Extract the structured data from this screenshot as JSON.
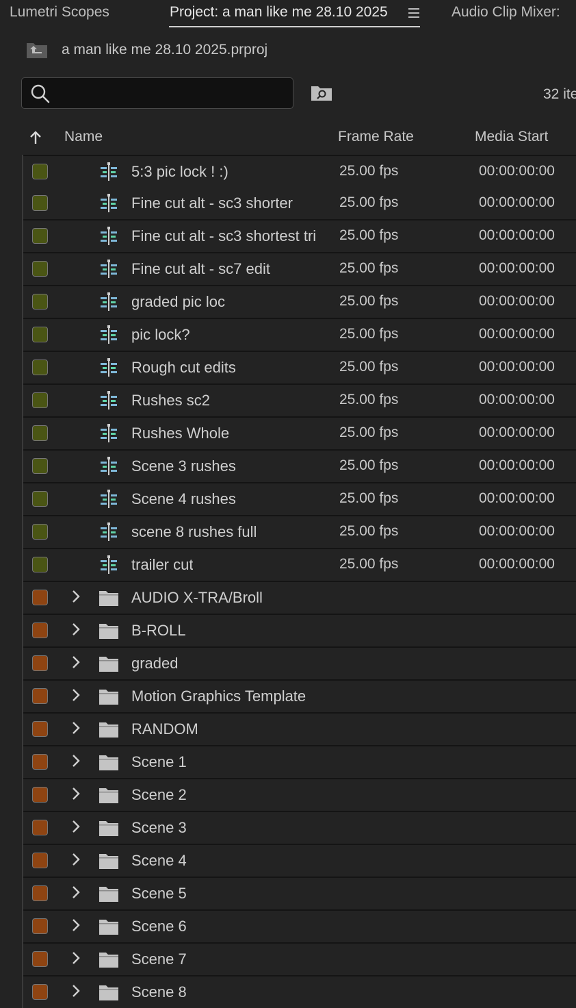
{
  "tabs": {
    "lumetri": "Lumetri Scopes",
    "project": "Project: a man like me 28.10 2025",
    "audio_mixer": "Audio Clip Mixer:"
  },
  "project": {
    "file_name": "a man like me 28.10 2025.prproj"
  },
  "search": {
    "value": "",
    "placeholder": ""
  },
  "items_count": "32 ite",
  "columns": {
    "name": "Name",
    "frame_rate": "Frame Rate",
    "media_start": "Media Start"
  },
  "colors": {
    "sequence_label": "#4a5514",
    "bin_label": "#8e4412",
    "sequence_icon": "#7fb8d8",
    "sequence_icon_accent": "#5fd3a8"
  },
  "rows": [
    {
      "type": "sequence",
      "name": "5:3 pic lock ! :)",
      "frame_rate": "25.00 fps",
      "media_start": "00:00:00:00"
    },
    {
      "type": "sequence",
      "name": "Fine cut alt - sc3 shorter",
      "frame_rate": "25.00 fps",
      "media_start": "00:00:00:00"
    },
    {
      "type": "sequence",
      "name": "Fine cut alt - sc3 shortest tri",
      "frame_rate": "25.00 fps",
      "media_start": "00:00:00:00"
    },
    {
      "type": "sequence",
      "name": "Fine cut alt - sc7 edit",
      "frame_rate": "25.00 fps",
      "media_start": "00:00:00:00"
    },
    {
      "type": "sequence",
      "name": "graded pic loc",
      "frame_rate": "25.00 fps",
      "media_start": "00:00:00:00"
    },
    {
      "type": "sequence",
      "name": "pic lock?",
      "frame_rate": "25.00 fps",
      "media_start": "00:00:00:00"
    },
    {
      "type": "sequence",
      "name": "Rough cut edits",
      "frame_rate": "25.00 fps",
      "media_start": "00:00:00:00"
    },
    {
      "type": "sequence",
      "name": "Rushes sc2",
      "frame_rate": "25.00 fps",
      "media_start": "00:00:00:00"
    },
    {
      "type": "sequence",
      "name": "Rushes Whole",
      "frame_rate": "25.00 fps",
      "media_start": "00:00:00:00"
    },
    {
      "type": "sequence",
      "name": "Scene 3 rushes",
      "frame_rate": "25.00 fps",
      "media_start": "00:00:00:00"
    },
    {
      "type": "sequence",
      "name": "Scene 4 rushes",
      "frame_rate": "25.00 fps",
      "media_start": "00:00:00:00"
    },
    {
      "type": "sequence",
      "name": "scene 8 rushes full",
      "frame_rate": "25.00 fps",
      "media_start": "00:00:00:00"
    },
    {
      "type": "sequence",
      "name": "trailer cut",
      "frame_rate": "25.00 fps",
      "media_start": "00:00:00:00"
    },
    {
      "type": "bin",
      "name": "AUDIO X-TRA/Broll"
    },
    {
      "type": "bin",
      "name": "B-ROLL"
    },
    {
      "type": "bin",
      "name": "graded"
    },
    {
      "type": "bin",
      "name": "Motion Graphics Template"
    },
    {
      "type": "bin",
      "name": "RANDOM"
    },
    {
      "type": "bin",
      "name": "Scene 1"
    },
    {
      "type": "bin",
      "name": "Scene 2"
    },
    {
      "type": "bin",
      "name": "Scene 3"
    },
    {
      "type": "bin",
      "name": "Scene 4"
    },
    {
      "type": "bin",
      "name": "Scene 5"
    },
    {
      "type": "bin",
      "name": "Scene 6"
    },
    {
      "type": "bin",
      "name": "Scene 7"
    },
    {
      "type": "bin",
      "name": "Scene 8"
    }
  ]
}
